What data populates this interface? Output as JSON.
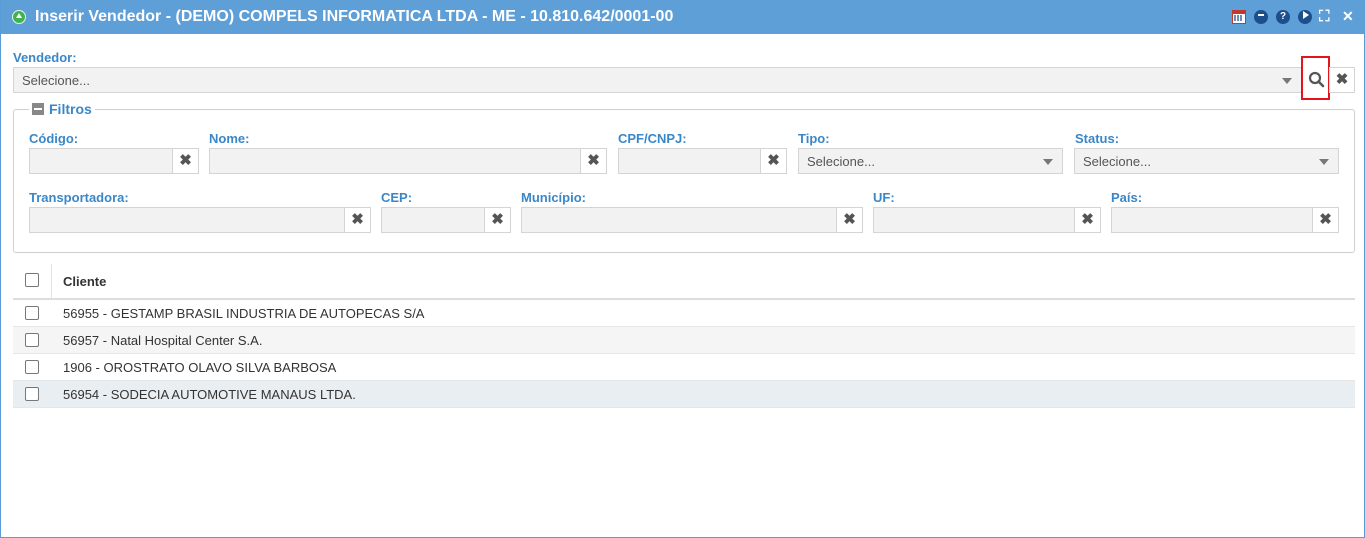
{
  "window": {
    "title": "Inserir Vendedor - (DEMO) COMPELS INFORMATICA LTDA - ME - 10.810.642/0001-00",
    "title_bar_icons": [
      "calendar-icon",
      "minimize-icon",
      "help-icon",
      "play-icon",
      "collapse-icon",
      "close-icon"
    ],
    "help_glyph": "?",
    "close_glyph": "✕",
    "collapse_glyph": "⛶",
    "accent_color": "#5e9fd8"
  },
  "vendedor": {
    "label": "Vendedor:",
    "placeholder": "Selecione...",
    "clear_glyph": "✖"
  },
  "filters": {
    "legend": "Filtros",
    "codigo_label": "Código:",
    "nome_label": "Nome:",
    "cpf_label": "CPF/CNPJ:",
    "tipo_label": "Tipo:",
    "tipo_placeholder": "Selecione...",
    "status_label": "Status:",
    "status_placeholder": "Selecione...",
    "transportadora_label": "Transportadora:",
    "cep_label": "CEP:",
    "municipio_label": "Município:",
    "uf_label": "UF:",
    "pais_label": "País:",
    "clear_glyph": "✖"
  },
  "grid": {
    "column_header": "Cliente",
    "rows": [
      "56955 - GESTAMP BRASIL INDUSTRIA DE AUTOPECAS S/A",
      "56957 - Natal Hospital Center S.A.",
      "1906 - OROSTRATO OLAVO SILVA BARBOSA",
      "56954 - SODECIA AUTOMOTIVE MANAUS LTDA."
    ],
    "row_colors": [
      "#ffffff",
      "#f5f5f5",
      "#ffffff",
      "#e9eef3"
    ]
  }
}
